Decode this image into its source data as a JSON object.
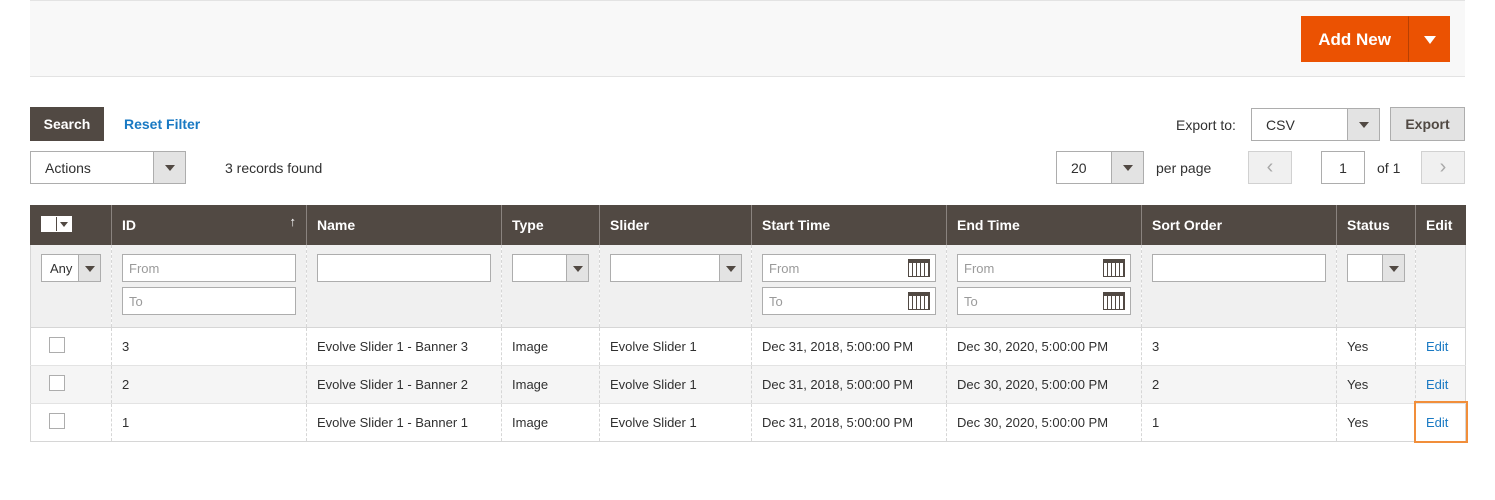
{
  "header": {
    "add_new_label": "Add New"
  },
  "toolbar": {
    "search_label": "Search",
    "reset_filter_label": "Reset Filter",
    "export_label": "Export to:",
    "export_format": "CSV",
    "export_button": "Export",
    "actions_label": "Actions",
    "records_found": "3 records found",
    "per_page_value": "20",
    "per_page_label": "per page",
    "page_current": "1",
    "page_of": "of 1",
    "prev_glyph": "‹",
    "next_glyph": "›"
  },
  "grid": {
    "columns": [
      {
        "key": "id",
        "label": "ID"
      },
      {
        "key": "name",
        "label": "Name"
      },
      {
        "key": "type",
        "label": "Type"
      },
      {
        "key": "slider",
        "label": "Slider"
      },
      {
        "key": "start",
        "label": "Start Time"
      },
      {
        "key": "end",
        "label": "End Time"
      },
      {
        "key": "sort",
        "label": "Sort Order"
      },
      {
        "key": "status",
        "label": "Status"
      },
      {
        "key": "edit",
        "label": "Edit"
      }
    ],
    "sort_indicator": "↑",
    "filters": {
      "mass_select_value": "Any",
      "from_placeholder": "From",
      "to_placeholder": "To"
    },
    "rows": [
      {
        "id": "3",
        "name": "Evolve Slider 1 - Banner 3",
        "type": "Image",
        "slider": "Evolve Slider 1",
        "start": "Dec 31, 2018, 5:00:00 PM",
        "end": "Dec 30, 2020, 5:00:00 PM",
        "sort": "3",
        "status": "Yes",
        "edit": "Edit"
      },
      {
        "id": "2",
        "name": "Evolve Slider 1 - Banner 2",
        "type": "Image",
        "slider": "Evolve Slider 1",
        "start": "Dec 31, 2018, 5:00:00 PM",
        "end": "Dec 30, 2020, 5:00:00 PM",
        "sort": "2",
        "status": "Yes",
        "edit": "Edit"
      },
      {
        "id": "1",
        "name": "Evolve Slider 1 - Banner 1",
        "type": "Image",
        "slider": "Evolve Slider 1",
        "start": "Dec 31, 2018, 5:00:00 PM",
        "end": "Dec 30, 2020, 5:00:00 PM",
        "sort": "1",
        "status": "Yes",
        "edit": "Edit"
      }
    ]
  },
  "colors": {
    "accent": "#eb5202",
    "header_bg": "#514943",
    "link": "#1979c3",
    "focus": "#f18e3a"
  }
}
